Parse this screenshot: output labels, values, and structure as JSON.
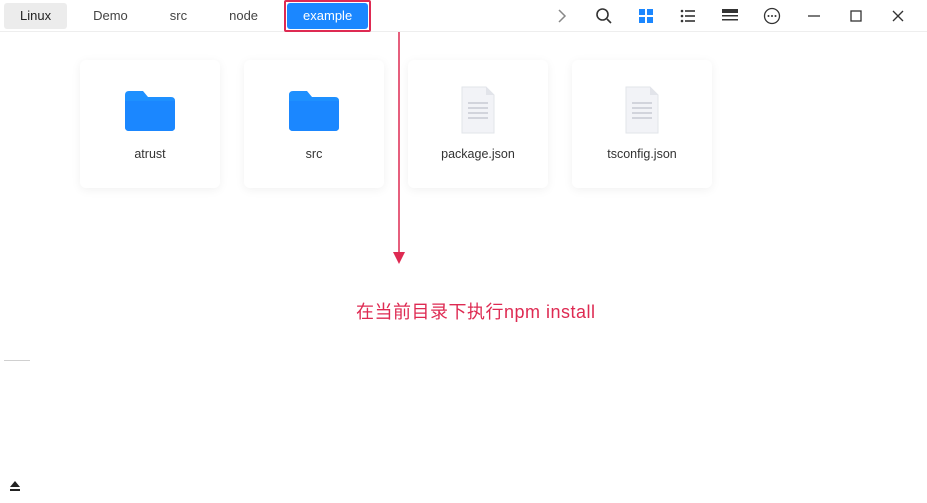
{
  "breadcrumbs": [
    {
      "label": "Linux"
    },
    {
      "label": "Demo"
    },
    {
      "label": "src"
    },
    {
      "label": "node"
    },
    {
      "label": "example"
    }
  ],
  "files": [
    {
      "name": "atrust",
      "type": "folder"
    },
    {
      "name": "src",
      "type": "folder"
    },
    {
      "name": "package.json",
      "type": "file"
    },
    {
      "name": "tsconfig.json",
      "type": "file"
    }
  ],
  "annotation": {
    "text": "在当前目录下执行npm install",
    "color": "#de2a52"
  },
  "toolbar_icons": {
    "chevron": "chevron-right-icon",
    "search": "search-icon",
    "grid": "grid-view-icon",
    "list": "list-view-icon",
    "details": "details-view-icon",
    "more": "more-icon",
    "minimize": "minimize-icon",
    "maximize": "maximize-icon",
    "close": "close-icon"
  }
}
